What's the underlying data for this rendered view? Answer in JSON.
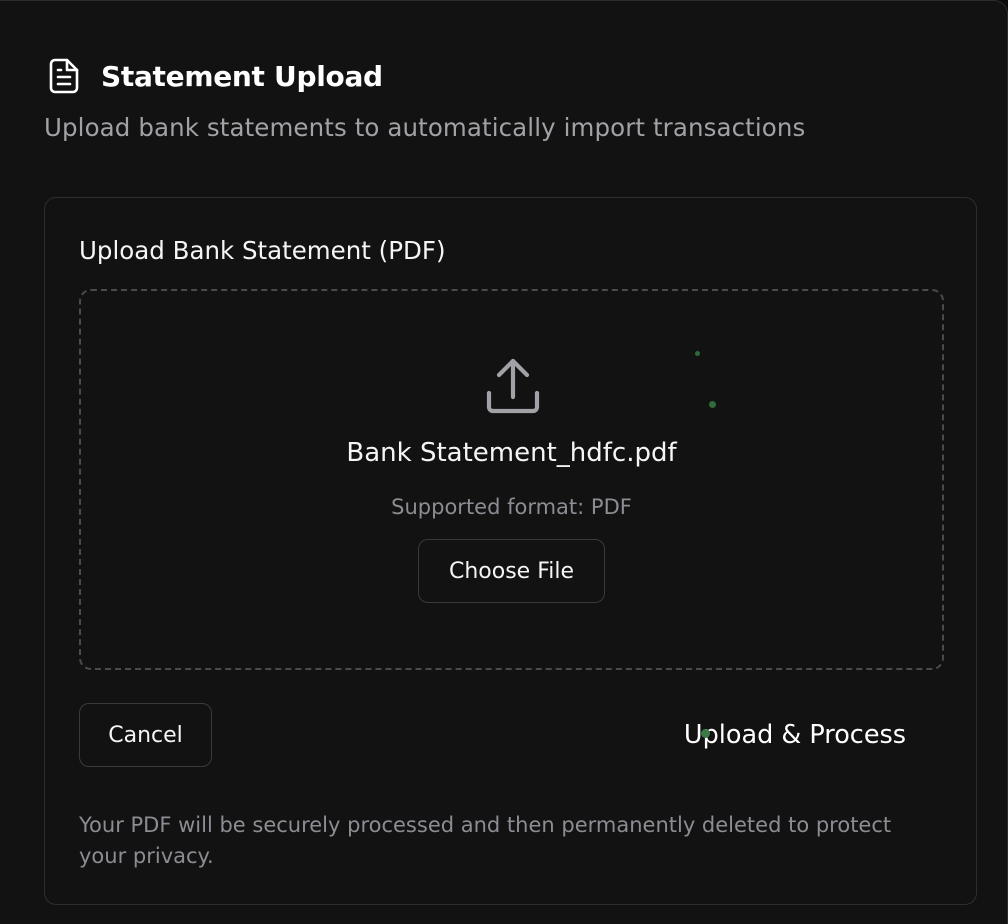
{
  "header": {
    "icon": "file-text-icon",
    "title": "Statement Upload",
    "subtitle": "Upload bank statements to automatically import transactions"
  },
  "form": {
    "label": "Upload Bank Statement (PDF)",
    "dropzone": {
      "icon": "upload-icon",
      "file_name": "Bank Statement_hdfc.pdf",
      "supported_format": "Supported format: PDF",
      "choose_file_label": "Choose File"
    },
    "actions": {
      "cancel_label": "Cancel",
      "upload_label": "Upload & Process"
    },
    "privacy_note": "Your PDF will be securely processed and then permanently deleted to protect your privacy."
  },
  "colors": {
    "background": "#121213",
    "border": "#2e2e31",
    "muted_text": "#8c8c92",
    "accent_dot": "#2f6b3a"
  }
}
